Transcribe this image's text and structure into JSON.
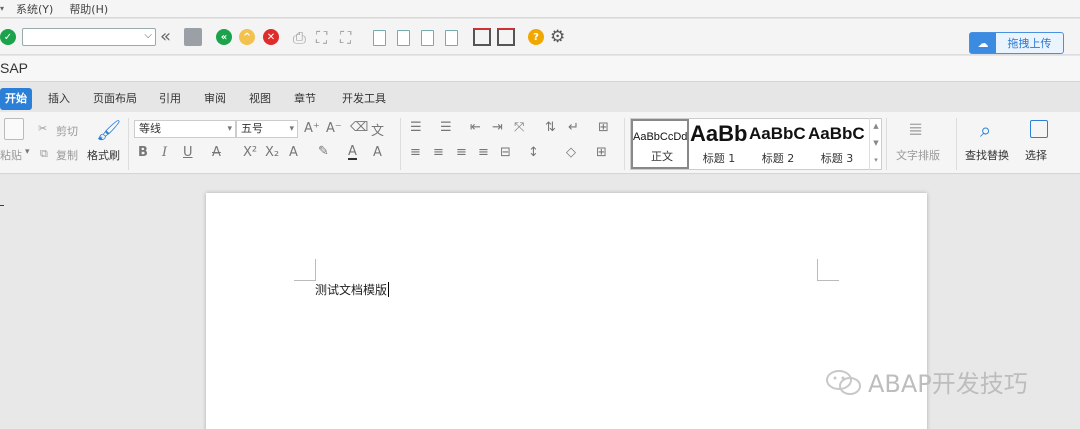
{
  "menu": {
    "items": [
      "系统(Y)",
      "帮助(H)"
    ]
  },
  "sap_toolbar": {
    "command_field_value": "",
    "upload_button": {
      "label": "拖拽上传"
    },
    "help_icon_glyph": "?"
  },
  "window": {
    "title": "SAP"
  },
  "ribbon": {
    "tabs": [
      "开始",
      "插入",
      "页面布局",
      "引用",
      "审阅",
      "视图",
      "章节",
      "开发工具"
    ],
    "active_tab": "开始",
    "clipboard": {
      "paste": "粘贴",
      "cut": "剪切",
      "copy": "复制",
      "format_painter": "格式刷"
    },
    "font": {
      "name": "等线",
      "size": "五号",
      "bold": "B",
      "italic": "I",
      "underline": "U",
      "strike": "A",
      "superscript": "X²",
      "subscript": "X₂",
      "effects": "A",
      "color": "A",
      "grow": "A⁺",
      "shrink": "A⁻"
    },
    "styles": [
      {
        "preview": "AaBbCcDd",
        "name": "正文",
        "selected": true
      },
      {
        "preview": "AaBb",
        "name": "标题 1"
      },
      {
        "preview": "AaBbC",
        "name": "标题 2"
      },
      {
        "preview": "AaBbC",
        "name": "标题 3"
      }
    ],
    "text_layout": "文字排版",
    "find_replace": "查找替换",
    "select": "选择"
  },
  "document": {
    "text": "测试文档模版"
  },
  "watermark": {
    "text": "ABAP开发技巧"
  },
  "colors": {
    "accent": "#2b7fd6",
    "ok_green": "#1aa34a",
    "cancel_red": "#e02b2b",
    "warn_orange": "#f0a800"
  }
}
